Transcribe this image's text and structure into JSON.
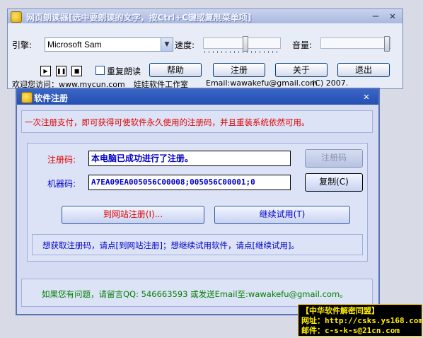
{
  "main_window": {
    "title": "网页朗读器[选中要朗读的文字，按Ctrl+C键或复制菜单项]",
    "engine_label": "引擎:",
    "engine_value": "Microsoft Sam",
    "speed_label": "速度:",
    "volume_label": "音量:",
    "speed_level": 0.55,
    "volume_level": 0.98,
    "repeat_label": "重复朗读",
    "repeat_checked": false,
    "buttons": {
      "help": "帮助",
      "register": "注册",
      "about": "关于",
      "exit": "退出"
    },
    "footer": {
      "visit": "欢迎您访问：www.mycun.com",
      "studio": "娃娃软件工作室",
      "email": "Email:wawakefu@gmail.com",
      "copyright": "(C)  2007."
    }
  },
  "register_dialog": {
    "title": "软件注册",
    "notice": "一次注册支付，即可获得可使软件永久使用的注册码，并且重装系统依然可用。",
    "regcode_label": "注册码:",
    "regcode_value": "本电脑已成功进行了注册。",
    "machine_label": "机器码:",
    "machine_value": "A7EA09EA005056C00008;005056C00001;0",
    "register_button": "注册码",
    "copy_button": "复制(C)",
    "web_register_button": "到网站注册(I)...",
    "trial_button": "继续试用(T)",
    "hint": "想获取注册码，请点[到网站注册]；想继续试用软件，请点[继续试用]。",
    "contact": "如果您有问题，请留言QQ:  546663593   或发送Email至:wawakefu@gmail.com。"
  },
  "stamp": {
    "line1": "【中华软件解密同盟】",
    "line2": "网址：http://csks.ys168.com",
    "line3": "邮件：c-s-k-s@21cn.com"
  },
  "colors": {
    "accent_red": "#e00000",
    "accent_blue": "#0000c8",
    "title_blue": "#2450b0"
  }
}
